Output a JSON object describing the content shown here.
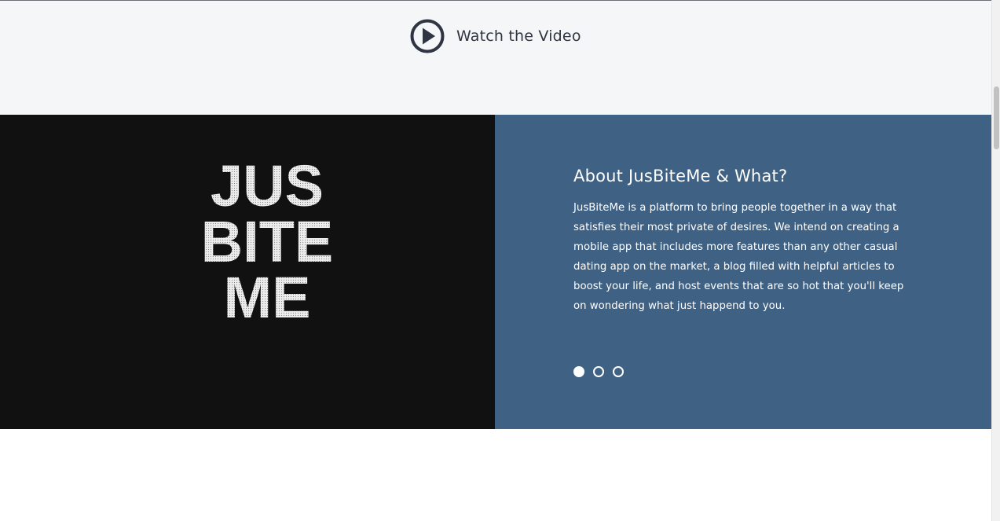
{
  "video": {
    "label": "Watch the Video",
    "icon": "play-circle-icon"
  },
  "logo": {
    "lines": [
      "JUS",
      "BITE",
      "ME"
    ]
  },
  "about": {
    "title": "About JusBiteMe & What?",
    "body": "JusBiteMe is a platform to bring people together in a way that satisfies their most private of desires. We intend on creating a mobile app that includes more features than any other casual dating app on the market, a blog filled with helpful articles to boost your life, and host events that are so hot that you'll keep on wondering what just happend to you."
  },
  "slider": {
    "slide_count": 3,
    "active_index": 0
  },
  "colors": {
    "video_band_bg": "#f5f6f8",
    "logo_panel_bg": "#111111",
    "info_panel_bg": "#3f6184",
    "icon_color": "#2f3542",
    "text_light": "#ffffff"
  }
}
